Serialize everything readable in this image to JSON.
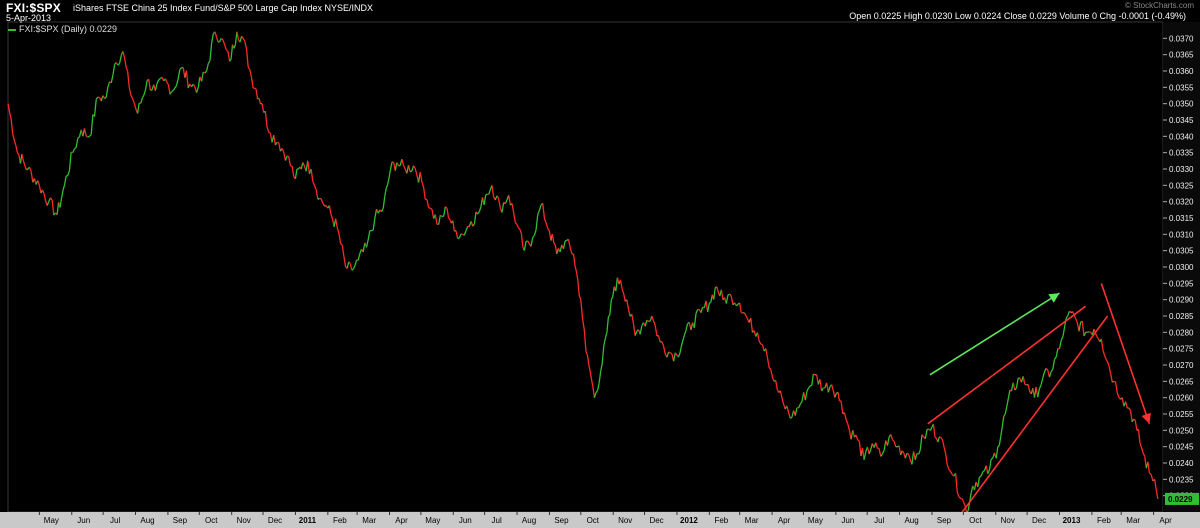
{
  "header": {
    "symbol": "FXI:$SPX",
    "description": "iShares FTSE China 25 Index Fund/S&P 500 Large Cap Index  NYSE/INDX",
    "date": "5-Apr-2013",
    "ohlc": "Open 0.0225  High 0.0230  Low 0.0224  Close 0.0229  Volume 0  Chg -0.0001 (-0.49%)",
    "brand": "© StockCharts.com"
  },
  "chart_data": {
    "type": "line",
    "legend": "FXI:$SPX (Daily) 0.0229",
    "last_value_label": "0.0229",
    "ylim": [
      0.0225,
      0.0375
    ],
    "y_ticks": [
      "0.0370",
      "0.0365",
      "0.0360",
      "0.0355",
      "0.0350",
      "0.0345",
      "0.0340",
      "0.0335",
      "0.0330",
      "0.0325",
      "0.0320",
      "0.0315",
      "0.0310",
      "0.0305",
      "0.0300",
      "0.0295",
      "0.0290",
      "0.0285",
      "0.0280",
      "0.0275",
      "0.0270",
      "0.0265",
      "0.0260",
      "0.0255",
      "0.0250",
      "0.0245",
      "0.0240",
      "0.0235",
      "0.0230"
    ],
    "x_ticks": [
      "May",
      "Jun",
      "Jul",
      "Aug",
      "Sep",
      "Oct",
      "Nov",
      "Dec",
      "2011",
      "Feb",
      "Mar",
      "Apr",
      "May",
      "Jun",
      "Jul",
      "Aug",
      "Sep",
      "Oct",
      "Nov",
      "Dec",
      "2012",
      "Feb",
      "Mar",
      "Apr",
      "May",
      "Jun",
      "Jul",
      "Aug",
      "Sep",
      "Oct",
      "Nov",
      "Dec",
      "2013",
      "Feb",
      "Mar",
      "Apr"
    ],
    "x_start": "2010-04-01",
    "x_end": "2013-04-10",
    "up_color": "#2ec02e",
    "down_color": "#ff2828",
    "series": [
      {
        "values": [
          [
            "2010-04-01",
            0.035
          ],
          [
            "2010-04-10",
            0.0335
          ],
          [
            "2010-04-20",
            0.033
          ],
          [
            "2010-05-01",
            0.0325
          ],
          [
            "2010-05-10",
            0.032
          ],
          [
            "2010-05-18",
            0.0316
          ],
          [
            "2010-05-25",
            0.0325
          ],
          [
            "2010-06-02",
            0.0335
          ],
          [
            "2010-06-10",
            0.0342
          ],
          [
            "2010-06-18",
            0.034
          ],
          [
            "2010-06-26",
            0.0352
          ],
          [
            "2010-07-04",
            0.0352
          ],
          [
            "2010-07-12",
            0.0362
          ],
          [
            "2010-07-20",
            0.0366
          ],
          [
            "2010-07-26",
            0.0355
          ],
          [
            "2010-08-03",
            0.0347
          ],
          [
            "2010-08-12",
            0.0357
          ],
          [
            "2010-08-20",
            0.0354
          ],
          [
            "2010-08-28",
            0.0357
          ],
          [
            "2010-09-06",
            0.0354
          ],
          [
            "2010-09-14",
            0.0361
          ],
          [
            "2010-09-22",
            0.0356
          ],
          [
            "2010-09-30",
            0.0355
          ],
          [
            "2010-10-08",
            0.036
          ],
          [
            "2010-10-16",
            0.0372
          ],
          [
            "2010-10-22",
            0.037
          ],
          [
            "2010-10-30",
            0.0363
          ],
          [
            "2010-11-06",
            0.0372
          ],
          [
            "2010-11-12",
            0.037
          ],
          [
            "2010-11-20",
            0.0358
          ],
          [
            "2010-11-30",
            0.035
          ],
          [
            "2010-12-08",
            0.0341
          ],
          [
            "2010-12-16",
            0.0338
          ],
          [
            "2010-12-24",
            0.0334
          ],
          [
            "2011-01-01",
            0.0327
          ],
          [
            "2011-01-08",
            0.0332
          ],
          [
            "2011-01-16",
            0.033
          ],
          [
            "2011-01-24",
            0.0321
          ],
          [
            "2011-02-01",
            0.0318
          ],
          [
            "2011-02-10",
            0.0312
          ],
          [
            "2011-02-18",
            0.03
          ],
          [
            "2011-02-24",
            0.0299
          ],
          [
            "2011-03-02",
            0.0302
          ],
          [
            "2011-03-10",
            0.0306
          ],
          [
            "2011-03-18",
            0.0315
          ],
          [
            "2011-03-26",
            0.0318
          ],
          [
            "2011-04-02",
            0.033
          ],
          [
            "2011-04-08",
            0.0332
          ],
          [
            "2011-04-16",
            0.033
          ],
          [
            "2011-04-24",
            0.0331
          ],
          [
            "2011-05-02",
            0.0326
          ],
          [
            "2011-05-10",
            0.0318
          ],
          [
            "2011-05-18",
            0.0313
          ],
          [
            "2011-05-26",
            0.0318
          ],
          [
            "2011-06-02",
            0.0311
          ],
          [
            "2011-06-10",
            0.031
          ],
          [
            "2011-06-18",
            0.0314
          ],
          [
            "2011-06-26",
            0.0317
          ],
          [
            "2011-07-02",
            0.0322
          ],
          [
            "2011-07-08",
            0.0325
          ],
          [
            "2011-07-16",
            0.0318
          ],
          [
            "2011-07-24",
            0.0322
          ],
          [
            "2011-08-01",
            0.0313
          ],
          [
            "2011-08-08",
            0.0305
          ],
          [
            "2011-08-16",
            0.0309
          ],
          [
            "2011-08-24",
            0.0319
          ],
          [
            "2011-09-01",
            0.0311
          ],
          [
            "2011-09-08",
            0.0304
          ],
          [
            "2011-09-16",
            0.0308
          ],
          [
            "2011-09-24",
            0.0304
          ],
          [
            "2011-10-01",
            0.029
          ],
          [
            "2011-10-06",
            0.0274
          ],
          [
            "2011-10-10",
            0.0268
          ],
          [
            "2011-10-14",
            0.026
          ],
          [
            "2011-10-20",
            0.0268
          ],
          [
            "2011-10-26",
            0.028
          ],
          [
            "2011-11-02",
            0.0294
          ],
          [
            "2011-11-08",
            0.0296
          ],
          [
            "2011-11-14",
            0.029
          ],
          [
            "2011-11-22",
            0.0279
          ],
          [
            "2011-11-30",
            0.0283
          ],
          [
            "2011-12-08",
            0.0285
          ],
          [
            "2011-12-16",
            0.0277
          ],
          [
            "2011-12-24",
            0.0274
          ],
          [
            "2012-01-01",
            0.0273
          ],
          [
            "2012-01-08",
            0.0279
          ],
          [
            "2012-01-16",
            0.0283
          ],
          [
            "2012-01-24",
            0.0286
          ],
          [
            "2012-02-01",
            0.0289
          ],
          [
            "2012-02-08",
            0.0294
          ],
          [
            "2012-02-14",
            0.029
          ],
          [
            "2012-02-22",
            0.0291
          ],
          [
            "2012-03-01",
            0.0289
          ],
          [
            "2012-03-10",
            0.0283
          ],
          [
            "2012-03-18",
            0.028
          ],
          [
            "2012-03-26",
            0.0275
          ],
          [
            "2012-04-03",
            0.0265
          ],
          [
            "2012-04-12",
            0.0258
          ],
          [
            "2012-04-20",
            0.0254
          ],
          [
            "2012-04-28",
            0.0258
          ],
          [
            "2012-05-06",
            0.0263
          ],
          [
            "2012-05-12",
            0.0267
          ],
          [
            "2012-05-20",
            0.0263
          ],
          [
            "2012-05-28",
            0.0264
          ],
          [
            "2012-06-06",
            0.0259
          ],
          [
            "2012-06-14",
            0.025
          ],
          [
            "2012-06-22",
            0.0247
          ],
          [
            "2012-06-28",
            0.0241
          ],
          [
            "2012-07-06",
            0.0246
          ],
          [
            "2012-07-14",
            0.0242
          ],
          [
            "2012-07-22",
            0.0248
          ],
          [
            "2012-07-30",
            0.0245
          ],
          [
            "2012-08-08",
            0.0243
          ],
          [
            "2012-08-16",
            0.0241
          ],
          [
            "2012-08-24",
            0.0248
          ],
          [
            "2012-09-01",
            0.0251
          ],
          [
            "2012-09-08",
            0.0248
          ],
          [
            "2012-09-14",
            0.0243
          ],
          [
            "2012-09-22",
            0.0236
          ],
          [
            "2012-09-30",
            0.0229
          ],
          [
            "2012-10-04",
            0.0225
          ],
          [
            "2012-10-10",
            0.0233
          ],
          [
            "2012-10-18",
            0.0236
          ],
          [
            "2012-10-26",
            0.0238
          ],
          [
            "2012-11-03",
            0.0245
          ],
          [
            "2012-11-10",
            0.0255
          ],
          [
            "2012-11-16",
            0.0262
          ],
          [
            "2012-11-24",
            0.0266
          ],
          [
            "2012-12-02",
            0.0264
          ],
          [
            "2012-12-08",
            0.026
          ],
          [
            "2012-12-16",
            0.0266
          ],
          [
            "2012-12-24",
            0.0268
          ],
          [
            "2013-01-01",
            0.0275
          ],
          [
            "2013-01-06",
            0.0282
          ],
          [
            "2013-01-12",
            0.0286
          ],
          [
            "2013-01-18",
            0.0283
          ],
          [
            "2013-01-26",
            0.028
          ],
          [
            "2013-02-03",
            0.0281
          ],
          [
            "2013-02-10",
            0.0278
          ],
          [
            "2013-02-16",
            0.0271
          ],
          [
            "2013-02-22",
            0.0265
          ],
          [
            "2013-03-02",
            0.026
          ],
          [
            "2013-03-10",
            0.0256
          ],
          [
            "2013-03-16",
            0.025
          ],
          [
            "2013-03-22",
            0.0243
          ],
          [
            "2013-03-28",
            0.0237
          ],
          [
            "2013-04-02",
            0.0235
          ],
          [
            "2013-04-05",
            0.0229
          ]
        ]
      }
    ],
    "annotations": [
      {
        "kind": "arrow",
        "color": "#5de85d",
        "from": [
          "2012-08-30",
          0.0267
        ],
        "to": [
          "2013-01-01",
          0.0292
        ]
      },
      {
        "kind": "line",
        "color": "#ff3030",
        "from": [
          "2012-08-28",
          0.0252
        ],
        "to": [
          "2013-01-26",
          0.0288
        ]
      },
      {
        "kind": "line",
        "color": "#ff3030",
        "from": [
          "2012-09-30",
          0.0225
        ],
        "to": [
          "2013-02-16",
          0.0285
        ]
      },
      {
        "kind": "arrow",
        "color": "#ff3030",
        "from": [
          "2013-02-10",
          0.0295
        ],
        "to": [
          "2013-03-28",
          0.0252
        ]
      }
    ]
  }
}
